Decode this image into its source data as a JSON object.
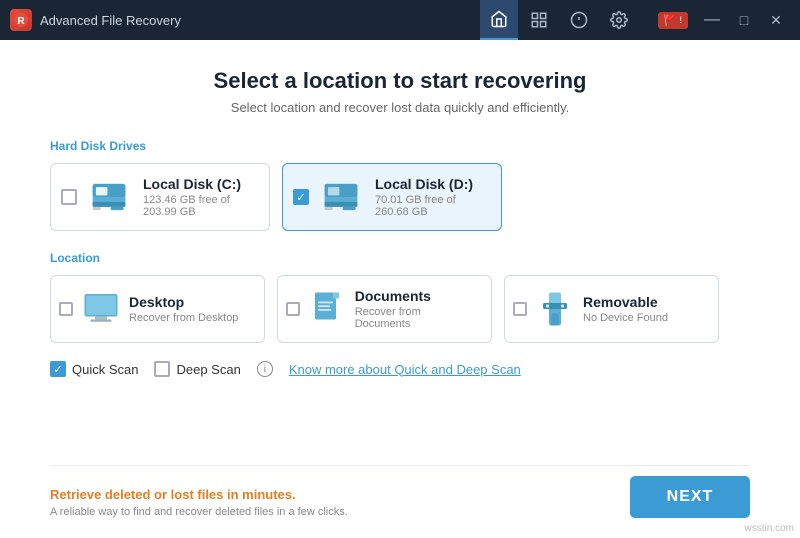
{
  "titlebar": {
    "logo": "R",
    "title": "Advanced File Recovery",
    "nav": [
      {
        "id": "home",
        "label": "Home",
        "active": true,
        "icon": "🏠"
      },
      {
        "id": "list",
        "label": "List",
        "active": false,
        "icon": "≡"
      },
      {
        "id": "info",
        "label": "Info",
        "active": false,
        "icon": "ℹ"
      },
      {
        "id": "settings",
        "label": "Settings",
        "active": false,
        "icon": "⚙"
      }
    ],
    "controls": {
      "flag": "🚩",
      "minimize": "—",
      "maximize": "□",
      "close": "✕"
    }
  },
  "page": {
    "title": "Select a location to start recovering",
    "subtitle": "Select location and recover lost data quickly and efficiently."
  },
  "hard_disk": {
    "section_label": "Hard Disk Drives",
    "drives": [
      {
        "name": "Local Disk (C:)",
        "space": "123.46 GB free of 203.99 GB",
        "selected": false
      },
      {
        "name": "Local Disk (D:)",
        "space": "70.01 GB free of 260.68 GB",
        "selected": true
      }
    ]
  },
  "location": {
    "section_label": "Location",
    "items": [
      {
        "name": "Desktop",
        "sub": "Recover from Desktop",
        "selected": false,
        "icon_type": "desktop"
      },
      {
        "name": "Documents",
        "sub": "Recover from Documents",
        "selected": false,
        "icon_type": "documents"
      },
      {
        "name": "Removable",
        "sub": "No Device Found",
        "selected": false,
        "icon_type": "usb"
      }
    ]
  },
  "scan": {
    "quick_scan": {
      "label": "Quick Scan",
      "checked": true
    },
    "deep_scan": {
      "label": "Deep Scan",
      "checked": false
    },
    "link": "Know more about Quick and Deep Scan"
  },
  "footer": {
    "promo": "Retrieve deleted or lost files in minutes.",
    "desc": "A reliable way to find and recover deleted files in a few clicks.",
    "next_button": "NEXT",
    "brand": "wsstin.com"
  }
}
